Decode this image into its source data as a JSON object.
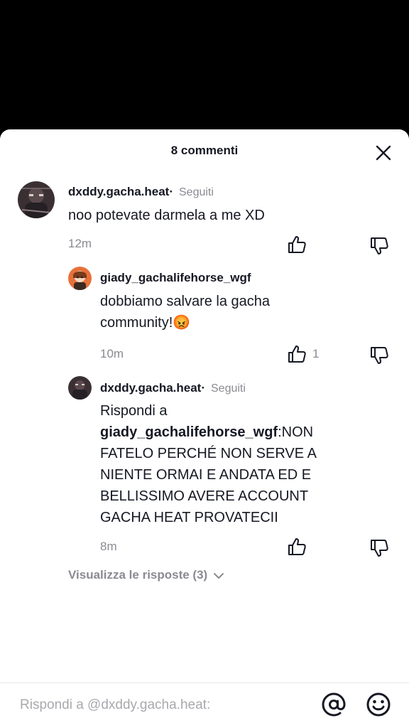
{
  "header": {
    "title": "8 commenti",
    "close_icon": "close-icon"
  },
  "comments": [
    {
      "username": "dxddy.gacha.heat·",
      "badge": "Seguiti",
      "text": "noo potevate darmela a me XD",
      "time": "12m",
      "likes": "",
      "avatar_icon": "user-avatar"
    },
    {
      "username": "giady_gachalifehorse_wgf",
      "badge": "",
      "text_line1": "dobbiamo salvare la gacha",
      "text_line2": "community!",
      "emoji": "😡",
      "time": "10m",
      "likes": "1",
      "avatar_icon": "user-avatar"
    },
    {
      "username": "dxddy.gacha.heat·",
      "badge": "Seguiti",
      "reply_prefix": "Rispondi a",
      "reply_target": "giady_gachalifehorse_wgf",
      "text_lines": [
        ":NON",
        "FATELO PERCHÉ NON SERVE A",
        "NIENTE ORMAI E ANDATA ED E",
        "BELLISSIMO AVERE ACCOUNT",
        "GACHA HEAT PROVATECII"
      ],
      "time": "8m",
      "likes": "",
      "avatar_icon": "user-avatar"
    }
  ],
  "view_replies": {
    "label": "Visualizza le risposte (3)",
    "icon": "chevron-down-icon"
  },
  "composer": {
    "placeholder": "Rispondi a @dxddy.gacha.heat:",
    "mention_icon": "at-icon",
    "emoji_icon": "emoji-icon"
  },
  "icons": {
    "like": "thumbs-up-icon",
    "dislike": "thumbs-down-icon"
  },
  "colors": {
    "text": "#161823",
    "secondary": "#8a8b91",
    "background": "#ffffff",
    "video_background": "#000000"
  }
}
